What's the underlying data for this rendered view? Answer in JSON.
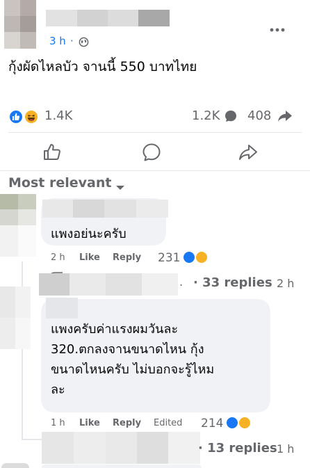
{
  "post": {
    "time": "3 h",
    "separator": "·",
    "text": "กุ้งผัดไหลบัว จานนี้ 550 บาทไทย",
    "reactions_count": "1.4K",
    "comments_count": "1.2K",
    "shares_count": "408"
  },
  "actions": {
    "like_icon": "thumbs-up-outline-icon",
    "comment_icon": "speech-bubble-icon",
    "share_icon": "share-arrow-icon"
  },
  "sort": {
    "label": "Most relevant"
  },
  "comments": [
    {
      "text": "แพงอย่นะครับ",
      "time": "2 h",
      "like": "Like",
      "reply": "Reply",
      "reactions": "231",
      "replies_link": "· 33 replies",
      "replies_time": "2 h"
    },
    {
      "text_lines": [
        "แพงครับค่าแรงผมวันละ",
        "320.ตกลงจานขนาดไหน กุ้ง",
        "ขนาดไหนครับ ไม่บอกจะรู้ไหม",
        "ละ"
      ],
      "time": "1 h",
      "like": "Like",
      "reply": "Reply",
      "edited": "Edited",
      "reactions": "214",
      "replies_link": "· 13 replies",
      "replies_time": "1 h"
    }
  ],
  "colors": {
    "facebook_blue": "#1877f2",
    "haha_yellow": "#f7b125",
    "bubble_gray": "#f0f2f5",
    "muted_text": "#65676b"
  }
}
